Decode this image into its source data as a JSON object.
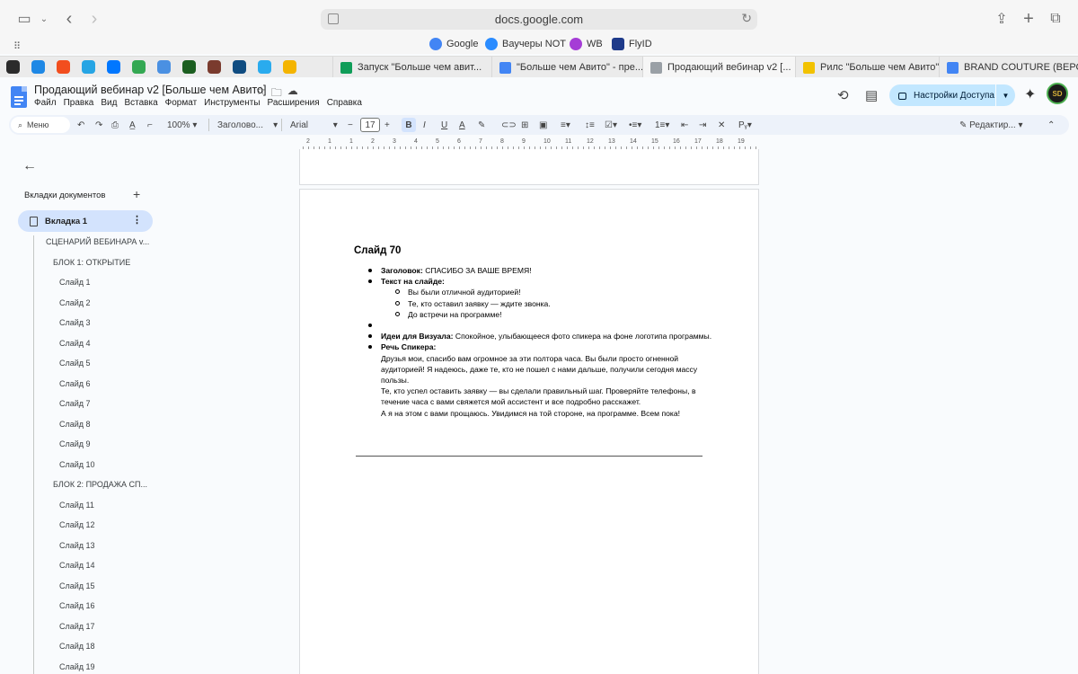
{
  "browser": {
    "url": "docs.google.com"
  },
  "favorites": [
    {
      "label": "Google",
      "color": "#4285f4"
    },
    {
      "label": "Ваучеры NOT",
      "color": "#2b8cff"
    },
    {
      "label": "WB",
      "color": "#a53dd6"
    },
    {
      "label": "FlyID",
      "color": "#1e3a8a"
    }
  ],
  "pinned_tabs": [
    "#2b2b2b",
    "#1e88e5",
    "#f24e1e",
    "#26a5e4",
    "#0077ff",
    "#34a853",
    "#4a90e2",
    "#1b5e20",
    "#7a3b2e",
    "#0f4c81",
    "#2aabee",
    "#f4b400"
  ],
  "tabs": [
    {
      "label": "Запуск \"Больше чем авит...",
      "color": "#0f9d58"
    },
    {
      "label": "\"Больше чем Авито\" - пре...",
      "color": "#4285f4"
    },
    {
      "label": "Продающий вебинар v2 [...",
      "color": "#9aa0a6"
    },
    {
      "label": "Рилс \"Больше чем Авито\"...",
      "color": "#f2c200"
    },
    {
      "label": "BRAND COUTURE (ВЕРСИ...",
      "color": "#4285f4"
    }
  ],
  "document": {
    "title": "Продающий вебинар v2 [Больше чем Авито]",
    "menu": [
      "Файл",
      "Правка",
      "Вид",
      "Вставка",
      "Формат",
      "Инструменты",
      "Расширения",
      "Справка"
    ],
    "share_label": "Настройки Доступа",
    "avatar_text": "SD"
  },
  "toolbar": {
    "menu_search": "Меню",
    "zoom": "100%",
    "style": "Заголово...",
    "font": "Arial",
    "font_size": "17",
    "edit_mode": "Редактир..."
  },
  "ruler": [
    "2",
    "1",
    "1",
    "2",
    "3",
    "4",
    "5",
    "6",
    "7",
    "8",
    "9",
    "10",
    "11",
    "12",
    "13",
    "14",
    "15",
    "16",
    "17",
    "18",
    "19"
  ],
  "sidebar": {
    "heading": "Вкладки документов",
    "active_tab": "Вкладка 1",
    "outline": [
      {
        "text": "СЦЕНАРИЙ ВЕБИНАРА v...",
        "level": 1
      },
      {
        "text": "БЛОК 1: ОТКРЫТИЕ",
        "level": 2
      },
      {
        "text": "Слайд 1",
        "level": 3
      },
      {
        "text": "Слайд 2",
        "level": 3
      },
      {
        "text": "Слайд 3",
        "level": 3
      },
      {
        "text": "Слайд 4",
        "level": 3
      },
      {
        "text": "Слайд 5",
        "level": 3
      },
      {
        "text": "Слайд 6",
        "level": 3
      },
      {
        "text": "Слайд 7",
        "level": 3
      },
      {
        "text": "Слайд 8",
        "level": 3
      },
      {
        "text": "Слайд 9",
        "level": 3
      },
      {
        "text": "Слайд 10",
        "level": 3
      },
      {
        "text": "БЛОК 2: ПРОДАЖА СП...",
        "level": 2
      },
      {
        "text": "Слайд 11",
        "level": 3
      },
      {
        "text": "Слайд 12",
        "level": 3
      },
      {
        "text": "Слайд 13",
        "level": 3
      },
      {
        "text": "Слайд 14",
        "level": 3
      },
      {
        "text": "Слайд 15",
        "level": 3
      },
      {
        "text": "Слайд 16",
        "level": 3
      },
      {
        "text": "Слайд 17",
        "level": 3
      },
      {
        "text": "Слайд 18",
        "level": 3
      },
      {
        "text": "Слайд 19",
        "level": 3
      }
    ]
  },
  "content": {
    "slide_title": "Слайд 70",
    "header_label": "Заголовок:",
    "header_text": " СПАСИБО ЗА ВАШЕ ВРЕМЯ!",
    "slide_text_label": "Текст на слайде:",
    "slide_lines": [
      "Вы были отличной аудиторией!",
      "Те, кто оставил заявку — ждите звонка.",
      "До встречи на программе!"
    ],
    "visual_label": "Идеи для Визуала:",
    "visual_text": " Спокойное, улыбающееся фото спикера на фоне логотипа программы.",
    "speech_label": "Речь Спикера:",
    "speech_paragraphs": [
      "Друзья мои, спасибо вам огромное за эти полтора часа. Вы были просто огненной аудиторией! Я надеюсь, даже те, кто не пошел с нами дальше, получили сегодня массу пользы.",
      "Те, кто успел оставить заявку — вы сделали правильный шаг. Проверяйте телефоны, в течение часа с вами свяжется мой ассистент и все подробно расскажет.",
      "А я на этом с вами прощаюсь. Увидимся на той стороне, на программе. Всем пока!"
    ]
  }
}
